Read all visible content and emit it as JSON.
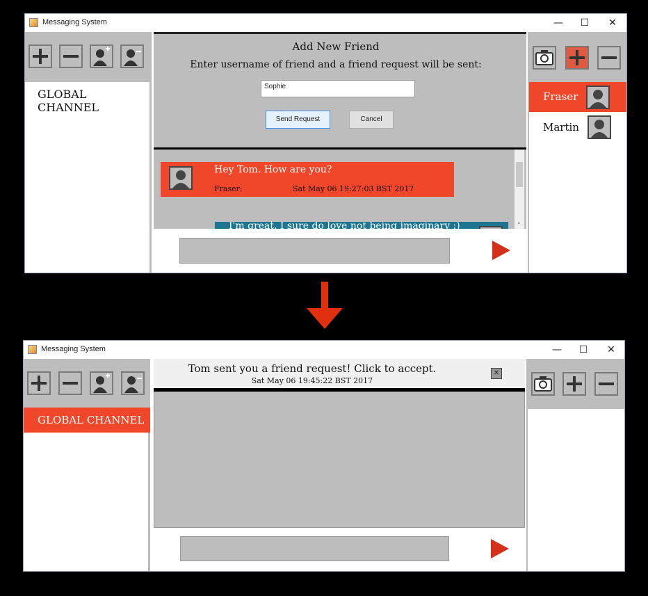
{
  "app": {
    "title": "Messaging System",
    "window_controls": {
      "minimize": "—",
      "maximize": "☐",
      "close": "✕"
    }
  },
  "before": {
    "left_tools": [
      "add-channel",
      "remove-channel",
      "add-user",
      "remove-user"
    ],
    "channels": [
      "GLOBAL CHANNEL"
    ],
    "dialog": {
      "title": "Add New Friend",
      "prompt": "Enter username of friend and a friend request will be sent:",
      "username_value": "Sophie",
      "send_label": "Send Request",
      "cancel_label": "Cancel"
    },
    "messages": [
      {
        "text": "Hey Tom. How are you?",
        "sender": "Fraser:",
        "time": "Sat May 06 19:27:03 BST 2017",
        "color": "#f0472a"
      },
      {
        "text": "I'm great. I sure do love not being imaginary :)",
        "sender": "",
        "time": "",
        "color": "#1e7592"
      }
    ],
    "friends": [
      {
        "name": "Fraser",
        "selected": true
      },
      {
        "name": "Martin",
        "selected": false
      }
    ],
    "right_tools": [
      "camera",
      "add-friend",
      "remove-friend"
    ],
    "right_add_active": true
  },
  "after": {
    "channels": [
      {
        "name": "GLOBAL CHANNEL",
        "selected": true
      }
    ],
    "notification": {
      "text": "Tom sent you a friend request! Click to accept.",
      "time": "Sat May 06 19:45:22 BST 2017",
      "close": "✕"
    },
    "friends": []
  },
  "colors": {
    "accent": "#f0472a",
    "panel_gray": "#bdbdbd",
    "message_blue": "#1e7592",
    "arrow_red": "#e0300e"
  }
}
